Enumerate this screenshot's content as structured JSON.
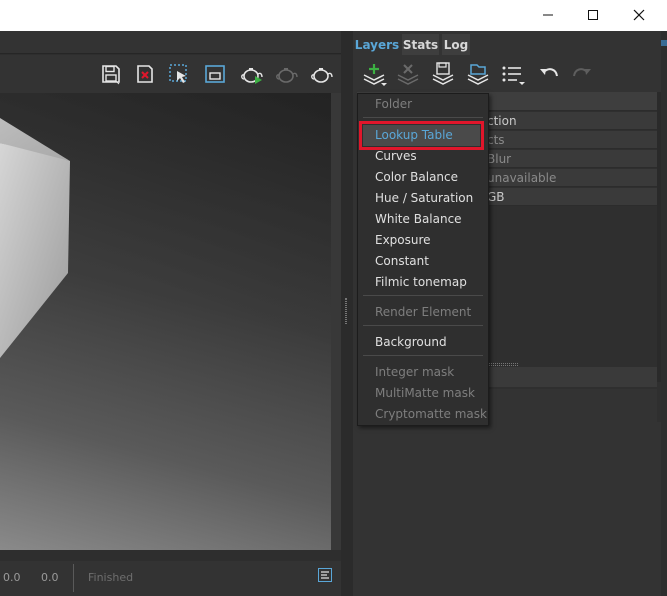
{
  "window": {
    "minimize_icon": "minimize-icon",
    "maximize_icon": "maximize-icon",
    "close_icon": "close-icon"
  },
  "viewport_toolbar": {
    "icons": [
      "save-icon",
      "clear-icon",
      "region-select-icon",
      "frame-icon",
      "render-teapot-icon",
      "stop-render-teapot-icon",
      "teapot-icon"
    ]
  },
  "statusbar": {
    "value1": "0.0",
    "value2": "0.0",
    "status": "Finished"
  },
  "tabs": [
    {
      "label": "Layers",
      "active": true
    },
    {
      "label": "Stats",
      "active": false
    },
    {
      "label": "Log",
      "active": false
    }
  ],
  "layers_toolbar": {
    "icons": [
      "add-layer-icon",
      "delete-layer-icon",
      "save-layers-icon",
      "load-layers-icon",
      "layer-list-icon",
      "undo-icon",
      "redo-icon"
    ]
  },
  "layer_rows": [
    {
      "text": "ction",
      "dim": false
    },
    {
      "text": "cts",
      "dim": true
    },
    {
      "text": "Blur",
      "dim": true
    },
    {
      "text": "unavailable",
      "dim": true
    },
    {
      "text": "GB",
      "dim": false
    }
  ],
  "menu": {
    "items": [
      {
        "label": "Folder",
        "disabled": true
      },
      {
        "label": "Lookup Table",
        "disabled": false,
        "highlighted": true
      },
      {
        "label": "Curves",
        "disabled": false
      },
      {
        "label": "Color Balance",
        "disabled": false
      },
      {
        "label": "Hue / Saturation",
        "disabled": false
      },
      {
        "label": "White Balance",
        "disabled": false
      },
      {
        "label": "Exposure",
        "disabled": false
      },
      {
        "label": "Constant",
        "disabled": false
      },
      {
        "label": "Filmic tonemap",
        "disabled": false
      },
      {
        "label": "Render Element",
        "disabled": true
      },
      {
        "label": "Background",
        "disabled": false
      },
      {
        "label": "Integer mask",
        "disabled": true
      },
      {
        "label": "MultiMatte mask",
        "disabled": true
      },
      {
        "label": "Cryptomatte mask",
        "disabled": true
      }
    ]
  },
  "colors": {
    "accent": "#5aa7d8",
    "highlight_box": "#e0162b",
    "panel_bg": "#333333"
  }
}
